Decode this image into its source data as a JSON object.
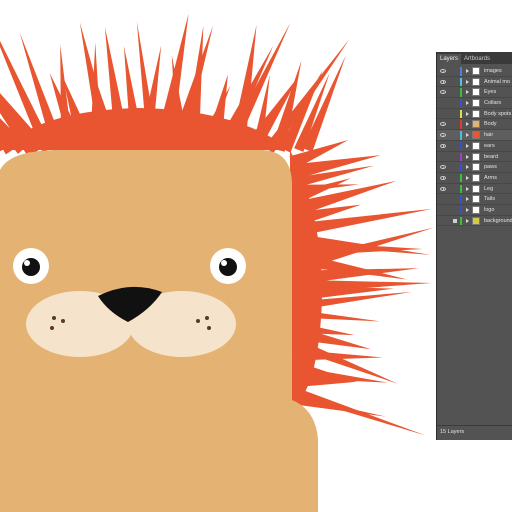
{
  "panel": {
    "tabs": [
      "Layers",
      "Artboards"
    ],
    "layers": [
      {
        "name": "images",
        "color": "#4f7de0",
        "thumb": "#ffffff",
        "visible": true,
        "locked": false
      },
      {
        "name": "Animal mo",
        "color": "#55c0e6",
        "thumb": "#ffffff",
        "visible": true,
        "locked": false
      },
      {
        "name": "Eyes",
        "color": "#37c23a",
        "thumb": "#ffffff",
        "visible": true,
        "locked": false
      },
      {
        "name": "Collars",
        "color": "#3a4fd6",
        "thumb": "#ffffff",
        "visible": false,
        "locked": false
      },
      {
        "name": "Body spots",
        "color": "#e0e040",
        "thumb": "#ffffff",
        "visible": false,
        "locked": false
      },
      {
        "name": "Body",
        "color": "#e03b3b",
        "thumb": "#e4b373",
        "visible": true,
        "locked": false
      },
      {
        "name": "hair",
        "color": "#4ac0d8",
        "thumb": "#e85530",
        "visible": true,
        "locked": false
      },
      {
        "name": "ears",
        "color": "#3a4fd6",
        "thumb": "#ffffff",
        "visible": true,
        "locked": false
      },
      {
        "name": "beard",
        "color": "#9a3fd6",
        "thumb": "#ffffff",
        "visible": false,
        "locked": false
      },
      {
        "name": "paws",
        "color": "#3a4fd6",
        "thumb": "#ffffff",
        "visible": true,
        "locked": false
      },
      {
        "name": "Arms",
        "color": "#37c23a",
        "thumb": "#ffffff",
        "visible": true,
        "locked": false
      },
      {
        "name": "Leg",
        "color": "#37c23a",
        "thumb": "#ffffff",
        "visible": true,
        "locked": false
      },
      {
        "name": "Tails",
        "color": "#3a4fd6",
        "thumb": "#ffffff",
        "visible": false,
        "locked": false
      },
      {
        "name": "logo",
        "color": "#3a4fd6",
        "thumb": "#ffffff",
        "visible": false,
        "locked": false
      },
      {
        "name": "background",
        "color": "#37c23a",
        "thumb": "#d6c84a",
        "visible": false,
        "locked": true
      }
    ],
    "count_label": "15 Layers"
  },
  "colors": {
    "mane": "#e85530",
    "body": "#e4b373",
    "muzzle": "#f6e3cb",
    "nose": "#111111"
  }
}
